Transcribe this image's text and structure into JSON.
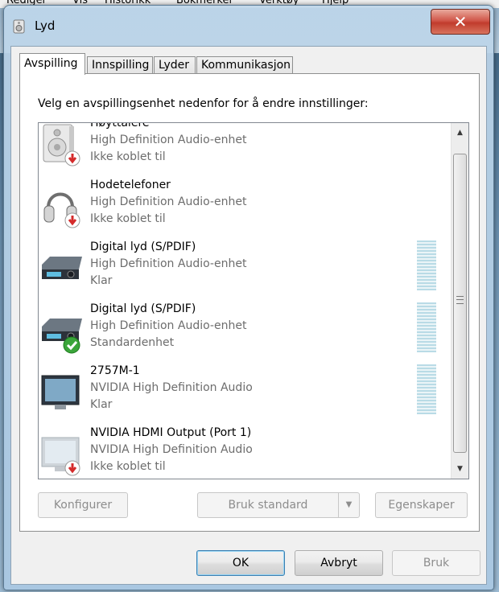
{
  "background": {
    "menu": [
      "Rediger",
      "Vis",
      "Historikk",
      "Bokmerker",
      "Verktøy",
      "Hjelp"
    ]
  },
  "window": {
    "title": "Lyd",
    "close_glyph": "✕"
  },
  "tabs": [
    {
      "label": "Avspilling",
      "active": true
    },
    {
      "label": "Innspilling",
      "active": false
    },
    {
      "label": "Lyder",
      "active": false
    },
    {
      "label": "Kommunikasjon",
      "active": false
    }
  ],
  "instruction": "Velg en avspillingsenhet nedenfor for å endre innstillinger:",
  "devices": [
    {
      "name": "Høyttalere",
      "driver": "High Definition Audio-enhet",
      "status": "Ikke koblet til",
      "icon": "speaker-icon",
      "badge": "disconnected",
      "meter": false
    },
    {
      "name": "Hodetelefoner",
      "driver": "High Definition Audio-enhet",
      "status": "Ikke koblet til",
      "icon": "headphones-icon",
      "badge": "disconnected",
      "meter": false
    },
    {
      "name": "Digital lyd (S/PDIF)",
      "driver": "High Definition Audio-enhet",
      "status": "Klar",
      "icon": "receiver-icon",
      "badge": "none",
      "meter": true
    },
    {
      "name": "Digital lyd (S/PDIF)",
      "driver": "High Definition Audio-enhet",
      "status": "Standardenhet",
      "icon": "receiver-icon",
      "badge": "default",
      "meter": true
    },
    {
      "name": "2757M-1",
      "driver": "NVIDIA High Definition Audio",
      "status": "Klar",
      "icon": "monitor-icon",
      "badge": "none",
      "meter": true
    },
    {
      "name": "NVIDIA HDMI Output (Port 1)",
      "driver": "NVIDIA High Definition Audio",
      "status": "Ikke koblet til",
      "icon": "monitor-icon",
      "badge": "disconnected",
      "meter": false
    }
  ],
  "buttons": {
    "configure": "Konfigurer",
    "set_default": "Bruk standard",
    "properties": "Egenskaper",
    "ok": "OK",
    "cancel": "Avbryt",
    "apply": "Bruk"
  },
  "colors": {
    "disconnected_badge": "#d42b2b",
    "default_badge": "#3aa53a"
  }
}
